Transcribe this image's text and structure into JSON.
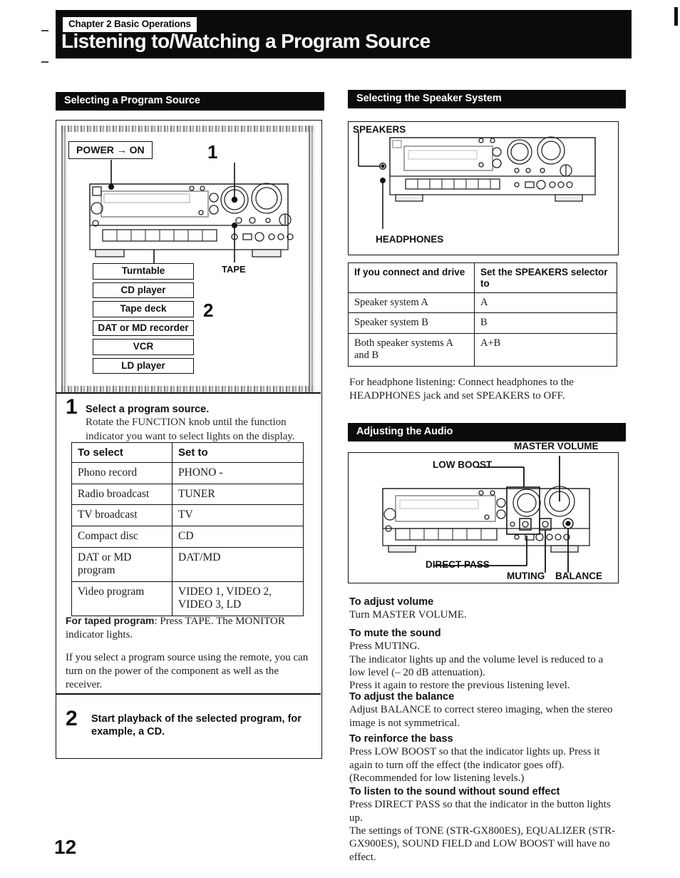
{
  "header": {
    "chapter": "Chapter 2 Basic Operations",
    "title": "Listening to/Watching a Program Source"
  },
  "page_number": "12",
  "sections": {
    "program_source": {
      "bar_title": "Selecting a Program Source",
      "figure": {
        "power_callout": "POWER → ON",
        "marker_1": "1",
        "marker_2": "2",
        "tape_label": "TAPE",
        "device_list": [
          "Turntable",
          "CD player",
          "Tape deck",
          "DAT or MD recorder",
          "VCR",
          "LD player"
        ]
      },
      "step1": {
        "number": "1",
        "heading": "Select a program source.",
        "body": "Rotate the FUNCTION knob until the function indicator you want to select lights on the display.",
        "table": {
          "headers": [
            "To select",
            "Set to"
          ],
          "rows": [
            [
              "Phono record",
              "PHONO -"
            ],
            [
              "Radio broadcast",
              "TUNER"
            ],
            [
              "TV broadcast",
              "TV"
            ],
            [
              "Compact disc",
              "CD"
            ],
            [
              "DAT or MD program",
              "DAT/MD"
            ],
            [
              "Video program",
              "VIDEO 1, VIDEO 2, VIDEO 3, LD"
            ]
          ]
        },
        "note_taped_label": "For taped program",
        "note_taped_text": ": Press TAPE.  The MONITOR indicator lights.",
        "note_remote": "If you select a program source using the remote, you can turn on the power of the component as well as the receiver."
      },
      "step2": {
        "number": "2",
        "heading": "Start playback of the selected program, for example, a CD."
      }
    },
    "speaker_system": {
      "bar_title": "Selecting the Speaker System",
      "figure": {
        "label_speakers": "SPEAKERS",
        "label_headphones": "HEADPHONES"
      },
      "table": {
        "headers": [
          "If you connect and drive",
          "Set the SPEAKERS selector to"
        ],
        "rows": [
          [
            "Speaker system A",
            "A"
          ],
          [
            "Speaker system B",
            "B"
          ],
          [
            "Both speaker systems A and B",
            "A+B"
          ]
        ]
      },
      "headphone_note": "For headphone listening: Connect headphones to the HEADPHONES jack and set SPEAKERS to OFF."
    },
    "adjusting_audio": {
      "bar_title": "Adjusting the Audio",
      "figure": {
        "label_low_boost": "LOW BOOST",
        "label_master_volume": "MASTER VOLUME",
        "label_direct_pass": "DIRECT PASS",
        "label_muting": "MUTING",
        "label_balance": "BALANCE"
      },
      "instructions": [
        {
          "heading": "To adjust volume",
          "lines": [
            "Turn MASTER VOLUME."
          ]
        },
        {
          "heading": "To mute the sound",
          "lines": [
            "Press MUTING.",
            "The indicator lights up and the volume level is reduced to a low level (– 20 dB attenuation).",
            "Press it again to restore the previous listening level."
          ]
        },
        {
          "heading": "To adjust the balance",
          "lines": [
            "Adjust BALANCE to correct stereo imaging, when the stereo image is not symmetrical."
          ]
        },
        {
          "heading": "To reinforce the bass",
          "lines": [
            "Press LOW BOOST so that the indicator lights up.  Press it again to turn off the effect (the indicator goes off).",
            "(Recommended for low listening levels.)"
          ]
        },
        {
          "heading": "To listen to the sound without sound effect",
          "lines": [
            "Press DIRECT PASS so that the indicator in the button lights up.",
            "The settings of TONE (STR-GX800ES), EQUALIZER (STR-GX900ES), SOUND FIELD and LOW BOOST will have no effect."
          ]
        }
      ]
    }
  }
}
